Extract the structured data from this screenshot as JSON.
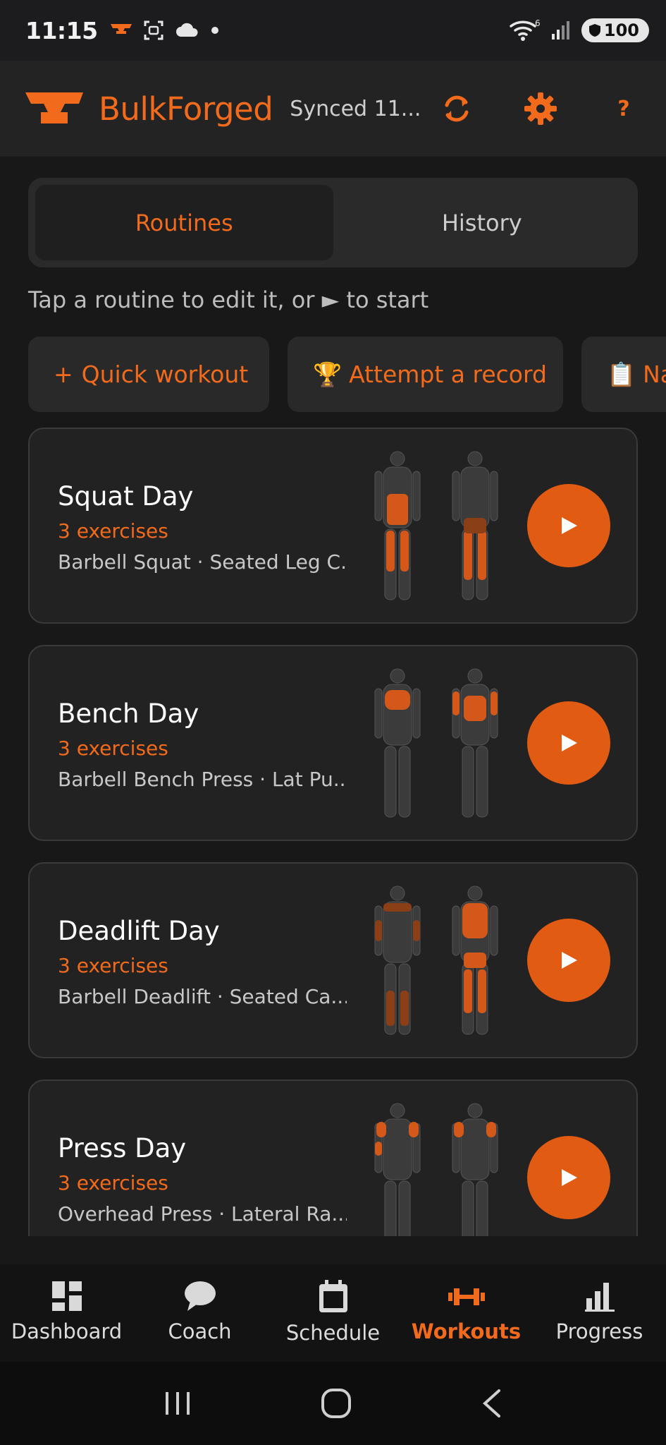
{
  "status_bar": {
    "time": "11:15",
    "network_badge": "6",
    "battery": "100"
  },
  "header": {
    "brand": "BulkForged",
    "sync_status": "Synced 11...",
    "help_label": "?"
  },
  "tabs": [
    {
      "label": "Routines",
      "active": true
    },
    {
      "label": "History",
      "active": false
    }
  ],
  "hint": "Tap a routine to edit it, or ► to start",
  "chips": [
    {
      "icon": "+",
      "label": "Quick workout"
    },
    {
      "icon": "🏆",
      "label": "Attempt a record"
    },
    {
      "icon": "📋",
      "label": "Na"
    }
  ],
  "routines": [
    {
      "name": "Squat Day",
      "count": "3 exercises",
      "exercises": "Barbell Squat · Seated Leg C...",
      "highlight": "legs"
    },
    {
      "name": "Bench Day",
      "count": "3 exercises",
      "exercises": "Barbell Bench Press · Lat Pu...",
      "highlight": "chest-back"
    },
    {
      "name": "Deadlift Day",
      "count": "3 exercises",
      "exercises": "Barbell Deadlift · Seated Ca...",
      "highlight": "posterior"
    },
    {
      "name": "Press Day",
      "count": "3 exercises",
      "exercises": "Overhead Press · Lateral Ra...",
      "highlight": "shoulders"
    }
  ],
  "nav": [
    {
      "label": "Dashboard",
      "icon": "dashboard-icon",
      "active": false
    },
    {
      "label": "Coach",
      "icon": "chat-icon",
      "active": false
    },
    {
      "label": "Schedule",
      "icon": "calendar-icon",
      "active": false
    },
    {
      "label": "Workouts",
      "icon": "dumbbell-icon",
      "active": true
    },
    {
      "label": "Progress",
      "icon": "bar-chart-icon",
      "active": false
    }
  ],
  "colors": {
    "accent": "#f26a1b",
    "play": "#e25b12",
    "background": "#181818",
    "card": "#222222"
  }
}
